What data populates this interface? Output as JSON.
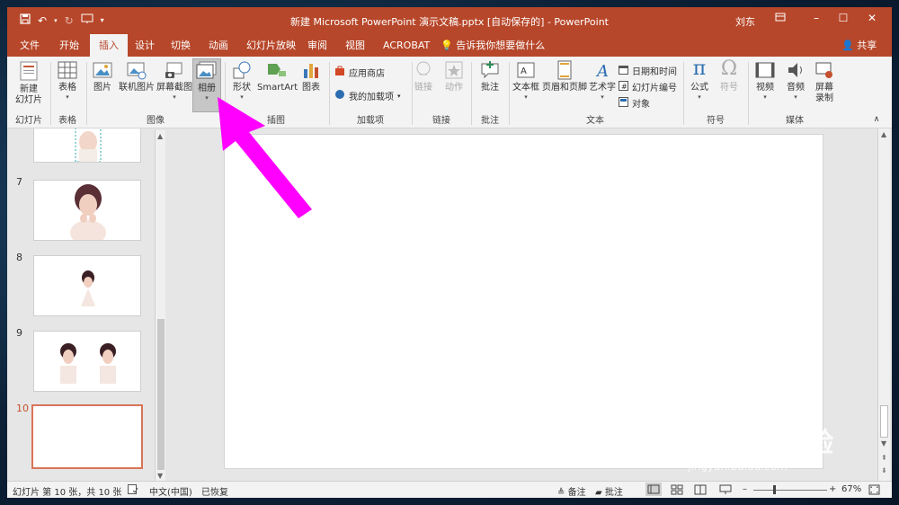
{
  "window": {
    "title": "新建 Microsoft PowerPoint 演示文稿.pptx [自动保存的]  -  PowerPoint",
    "user": "刘东"
  },
  "tabs": [
    "文件",
    "开始",
    "插入",
    "设计",
    "切换",
    "动画",
    "幻灯片放映",
    "审阅",
    "视图",
    "ACROBAT"
  ],
  "active_tab": "插入",
  "tell_me": "告诉我你想要做什么",
  "share": "共享",
  "ribbon": {
    "new_slide": "新建",
    "new_slide_2": "幻灯片",
    "table": "表格",
    "picture": "图片",
    "online_picture": "联机图片",
    "screenshot": "屏幕截图",
    "album": "相册",
    "shapes": "形状",
    "smartart": "SmartArt",
    "chart": "图表",
    "store": "应用商店",
    "my_addins": "我的加载项",
    "link": "链接",
    "action": "动作",
    "comment": "批注",
    "textbox": "文本框",
    "header_footer": "页眉和页脚",
    "wordart": "艺术字",
    "date_time": "日期和时间",
    "slide_number": "幻灯片编号",
    "object": "对象",
    "equation": "公式",
    "symbol": "符号",
    "video": "视频",
    "audio": "音频",
    "screen_rec": "屏幕",
    "screen_rec_2": "录制"
  },
  "groups": {
    "slides": "幻灯片",
    "tables": "表格",
    "images": "图像",
    "illustrations": "插图",
    "addins": "加载项",
    "links": "链接",
    "comments": "批注",
    "text": "文本",
    "symbols": "符号",
    "media": "媒体"
  },
  "slides": [
    "7",
    "8",
    "9",
    "10"
  ],
  "status": {
    "slide_info": "幻灯片 第 10 张，共 10 张",
    "language": "中文(中国)",
    "recovered": "已恢复",
    "notes": "备注",
    "comments": "批注",
    "zoom": "67%"
  },
  "watermark": {
    "brand": "Baidu经验",
    "url": "jingyan.baidu.com"
  },
  "colors": {
    "accent": "#b7472a",
    "arrow": "#ff00ff"
  }
}
